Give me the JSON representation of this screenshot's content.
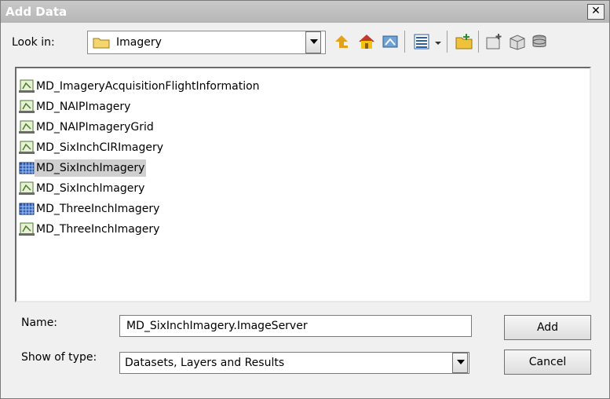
{
  "window": {
    "title": "Add Data",
    "close_glyph": "✕"
  },
  "look_in": {
    "label": "Look in:",
    "value": "Imagery",
    "icon": "folder-icon"
  },
  "toolbar": {
    "icons": [
      "up-one-level-icon",
      "home-icon",
      "connect-to-folder-icon",
      "view-list-icon",
      "view-dropdown-icon",
      "new-folder-icon",
      "new-item-icon",
      "new-box-icon",
      "catalog-icon"
    ]
  },
  "files": [
    {
      "name": "MD_ImageryAcquisitionFlightInformation",
      "icon": "feature-class-icon",
      "selected": false
    },
    {
      "name": "MD_NAIPImagery",
      "icon": "feature-class-icon",
      "selected": false
    },
    {
      "name": "MD_NAIPImageryGrid",
      "icon": "feature-class-icon",
      "selected": false
    },
    {
      "name": "MD_SixInchCIRImagery",
      "icon": "feature-class-icon",
      "selected": false
    },
    {
      "name": "MD_SixInchImagery",
      "icon": "image-service-icon",
      "selected": true
    },
    {
      "name": "MD_SixInchImagery",
      "icon": "feature-class-icon",
      "selected": false
    },
    {
      "name": "MD_ThreeInchImagery",
      "icon": "image-service-icon",
      "selected": false
    },
    {
      "name": "MD_ThreeInchImagery",
      "icon": "feature-class-icon",
      "selected": false
    }
  ],
  "name_field": {
    "label": "Name:",
    "value": "MD_SixInchImagery.ImageServer"
  },
  "type_field": {
    "label": "Show of type:",
    "value": "Datasets, Layers and Results"
  },
  "buttons": {
    "add": "Add",
    "cancel": "Cancel"
  },
  "colors": {
    "title_bar": "#bdbdbd",
    "selection": "#cfcfcf",
    "folder": "#f5d56e"
  }
}
